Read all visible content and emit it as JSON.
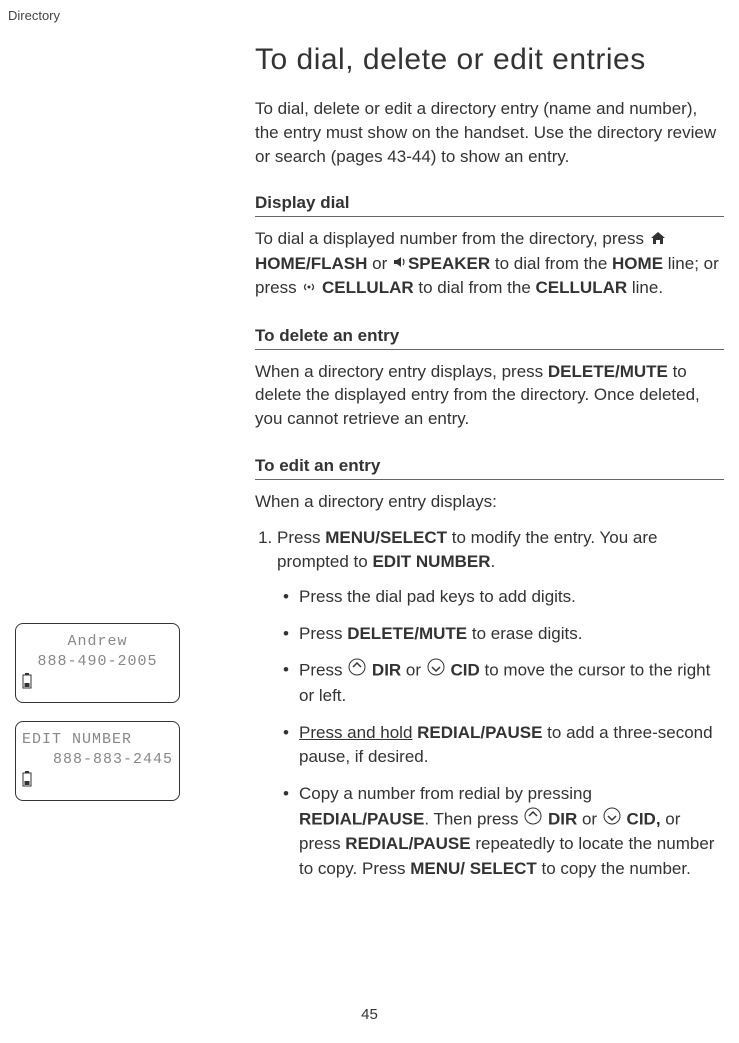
{
  "breadcrumb": "Directory",
  "title": "To dial, delete or edit entries",
  "intro": "To dial, delete or edit a directory entry (name and number), the entry must show on the handset. Use the directory review or search (pages 43-44) to show an entry.",
  "sections": {
    "display_dial": {
      "header": "Display dial",
      "p1a": "To dial a displayed number from the directory, press ",
      "home_flash_a": "HOME",
      "home_flash_b": "/FLASH",
      "p1b": " or ",
      "speaker": "SPEAKER",
      "p1c": " to dial from the ",
      "home_line": "HOME",
      "p1d": " line; or press ",
      "cellular_btn": "CELLULAR",
      "p1e": " to dial from the ",
      "cell_line": "CELLULAR",
      "p1f": " line."
    },
    "delete_entry": {
      "header": "To delete an entry",
      "p1a": "When a directory entry displays, press ",
      "del_a": "DELETE",
      "del_b": "/MUTE",
      "p1b": " to delete the displayed entry from the directory. Once deleted, you cannot retrieve an entry."
    },
    "edit_entry": {
      "header": "To edit an entry",
      "lead": "When a directory entry displays:",
      "step1a": "Press ",
      "menu_a": "MENU/",
      "menu_b": "SELECT",
      "step1b": " to modify the entry. You are prompted to ",
      "edit_number": "EDIT NUMBER",
      "step1c": ".",
      "b1": "Press the dial pad keys to add digits.",
      "b2a": "Press ",
      "b2_del_a": "DELETE",
      "b2_del_b": "/MUTE",
      "b2b": " to erase digits.",
      "b3a": "Press ",
      "dir": "DIR",
      "b3b": " or ",
      "cid": "CID",
      "b3c": " to move the cursor to the right or left.",
      "b4a": "Press and hold",
      "b4_rp_a": "REDIAL/",
      "b4_rp_b": "PAUSE",
      "b4b": " to add a three-second pause, if desired.",
      "b5a": "Copy a number from redial by pressing ",
      "b5_rp_a": "REDIAL",
      "b5_rp_b": "/PAUSE",
      "b5b": ". Then press ",
      "b5c": " or ",
      "cid2": "CID,",
      "b5d": " or press ",
      "b5_rp2_a": "REDIAL",
      "b5_rp2_b": "/PAUSE",
      "b5e": " repeatedly to locate the number to copy. Press ",
      "b5_ms_a": "MENU/",
      "b5_ms_b": "SELECT",
      "b5f": " to copy the number."
    }
  },
  "lcd": {
    "screen1": {
      "name": "Andrew",
      "number": "888-490-2005"
    },
    "screen2": {
      "label": "EDIT NUMBER",
      "number": "888-883-2445"
    }
  },
  "page_number": "45"
}
